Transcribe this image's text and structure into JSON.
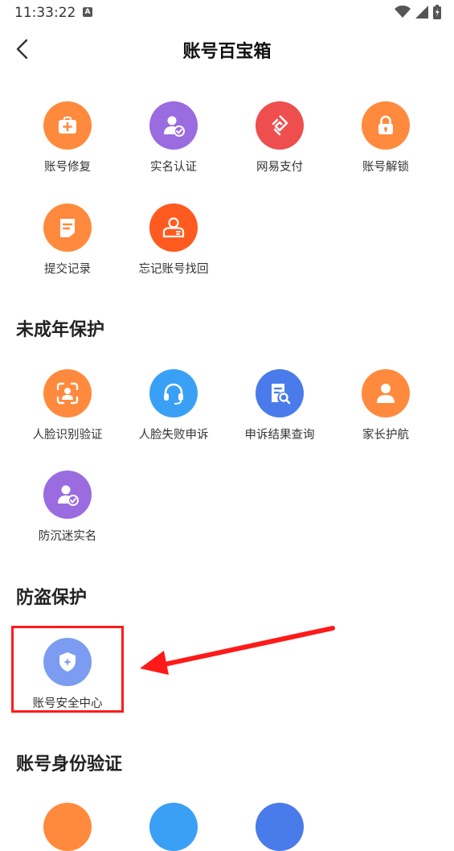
{
  "status_bar": {
    "time": "11:33:22",
    "notification_badge": "A",
    "icons": [
      "wifi-icon",
      "signal-icon",
      "battery-charging-icon"
    ]
  },
  "header": {
    "title": "账号百宝箱",
    "back_icon": "chevron-left-icon"
  },
  "section_general": {
    "items": [
      {
        "label": "账号修复",
        "icon": "medical-kit-icon",
        "color": "#FF8A3D"
      },
      {
        "label": "实名认证",
        "icon": "user-verified-icon",
        "color": "#9B6BE0"
      },
      {
        "label": "网易支付",
        "icon": "netease-pay-icon",
        "color": "#EE4E4E"
      },
      {
        "label": "账号解锁",
        "icon": "lock-icon",
        "color": "#FF8A3D"
      },
      {
        "label": "提交记录",
        "icon": "document-icon",
        "color": "#FF8A3D"
      },
      {
        "label": "忘记账号找回",
        "icon": "id-card-icon",
        "color": "#FF5A1F"
      }
    ]
  },
  "section_minor": {
    "title": "未成年保护",
    "items": [
      {
        "label": "人脸识别验证",
        "icon": "face-scan-icon",
        "color": "#FF8A3D"
      },
      {
        "label": "人脸失败申诉",
        "icon": "headset-icon",
        "color": "#3AA0F5"
      },
      {
        "label": "申诉结果查询",
        "icon": "search-document-icon",
        "color": "#4A7BEA"
      },
      {
        "label": "家长护航",
        "icon": "person-icon",
        "color": "#FF8A3D"
      },
      {
        "label": "防沉迷实名",
        "icon": "user-verified-icon",
        "color": "#9B6BE0"
      }
    ]
  },
  "section_theft": {
    "title": "防盗保护",
    "items": [
      {
        "label": "账号安全中心",
        "icon": "shield-icon",
        "color": "#7B9CF0"
      }
    ]
  },
  "section_identity": {
    "title": "账号身份验证"
  },
  "annotation": {
    "highlight_color": "#FF1A1A"
  }
}
